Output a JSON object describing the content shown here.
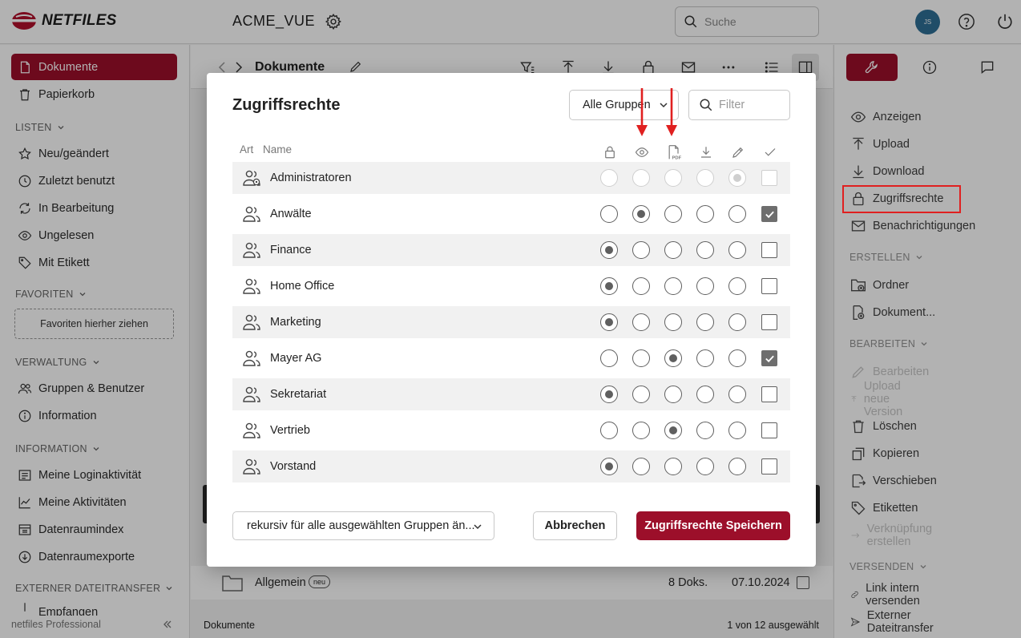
{
  "app": {
    "logo_text": "NETFILES",
    "title": "ACME_VUE",
    "search_placeholder": "Suche",
    "avatar_initials": "JS"
  },
  "sidebar": {
    "items_top": [
      {
        "label": "Dokumente",
        "icon": "document-icon",
        "active": true
      },
      {
        "label": "Papierkorb",
        "icon": "trash-icon"
      }
    ],
    "section_lists": "LISTEN",
    "lists": [
      {
        "label": "Neu/geändert",
        "icon": "star-icon"
      },
      {
        "label": "Zuletzt benutzt",
        "icon": "clock-icon"
      },
      {
        "label": "In Bearbeitung",
        "icon": "refresh-icon"
      },
      {
        "label": "Ungelesen",
        "icon": "eye-icon"
      },
      {
        "label": "Mit Etikett",
        "icon": "tag-icon"
      }
    ],
    "section_favorites": "FAVORITEN",
    "favorites_dropzone": "Favoriten hierher ziehen",
    "section_admin": "VERWALTUNG",
    "admin": [
      {
        "label": "Gruppen & Benutzer",
        "icon": "users-icon"
      },
      {
        "label": "Information",
        "icon": "info-icon"
      }
    ],
    "section_info": "INFORMATION",
    "info": [
      {
        "label": "Meine Loginaktivität",
        "icon": "list-icon"
      },
      {
        "label": "Meine Aktivitäten",
        "icon": "chart-icon"
      },
      {
        "label": "Datenraumindex",
        "icon": "index-icon"
      },
      {
        "label": "Datenraumexporte",
        "icon": "export-icon"
      }
    ],
    "section_transfer": "EXTERNER DATEITRANSFER",
    "transfer_item": "Empfangen",
    "footer": "netfiles Professional"
  },
  "main": {
    "breadcrumb": "Dokumente",
    "row": {
      "name": "Allgemein",
      "badge": "neu",
      "count": "8 Doks.",
      "date": "07.10.2024"
    },
    "status_left": "Dokumente",
    "status_right": "1 von 12 ausgewählt"
  },
  "right_panel": {
    "actions": [
      {
        "label": "Anzeigen",
        "icon": "eye-icon"
      },
      {
        "label": "Upload",
        "icon": "upload-icon"
      },
      {
        "label": "Download",
        "icon": "download-icon"
      },
      {
        "label": "Zugriffsrechte",
        "icon": "lock-icon"
      },
      {
        "label": "Benachrichtigungen",
        "icon": "mail-icon"
      }
    ],
    "section_create": "ERSTELLEN",
    "create": [
      {
        "label": "Ordner",
        "icon": "folder-add-icon"
      },
      {
        "label": "Dokument...",
        "icon": "document-add-icon"
      }
    ],
    "section_edit": "BEARBEITEN",
    "edit": [
      {
        "label": "Bearbeiten",
        "icon": "pencil-icon",
        "disabled": true
      },
      {
        "label": "Upload neue Version",
        "icon": "upload-icon",
        "disabled": true
      },
      {
        "label": "Löschen",
        "icon": "trash-icon"
      },
      {
        "label": "Kopieren",
        "icon": "copy-icon"
      },
      {
        "label": "Verschieben",
        "icon": "move-icon"
      },
      {
        "label": "Etiketten",
        "icon": "tag-icon"
      },
      {
        "label": "Verknüpfung erstellen",
        "icon": "arrow-right-icon",
        "disabled": true
      }
    ],
    "section_send": "VERSENDEN",
    "send": [
      {
        "label": "Link intern versenden",
        "icon": "link-icon"
      },
      {
        "label": "Externer Dateitransfer",
        "icon": "send-icon"
      }
    ]
  },
  "modal": {
    "title": "Zugriffsrechte",
    "group_select": "Alle Gruppen",
    "filter_placeholder": "Filter",
    "col_type": "Art",
    "col_name": "Name",
    "perm_columns": [
      "lock-icon",
      "eye-icon",
      "pdf-icon",
      "download-icon",
      "pencil-icon",
      "check-icon"
    ],
    "rows": [
      {
        "name": "Administratoren",
        "admin": true,
        "selected": 4,
        "check": false,
        "disabled": true
      },
      {
        "name": "Anwälte",
        "selected": 1,
        "check": true
      },
      {
        "name": "Finance",
        "selected": 0,
        "check": false
      },
      {
        "name": "Home Office",
        "selected": 0,
        "check": false
      },
      {
        "name": "Marketing",
        "selected": 0,
        "check": false
      },
      {
        "name": "Mayer AG",
        "selected": 2,
        "check": true
      },
      {
        "name": "Sekretariat",
        "selected": 0,
        "check": false
      },
      {
        "name": "Vertrieb",
        "selected": 2,
        "check": false
      },
      {
        "name": "Vorstand",
        "selected": 0,
        "check": false
      }
    ],
    "recursive_select": "rekursiv für alle ausgewählten Gruppen än...",
    "cancel": "Abbrechen",
    "save": "Zugriffsrechte Speichern"
  },
  "colors": {
    "brand": "#9c0f2a",
    "annotation": "#e02020"
  }
}
